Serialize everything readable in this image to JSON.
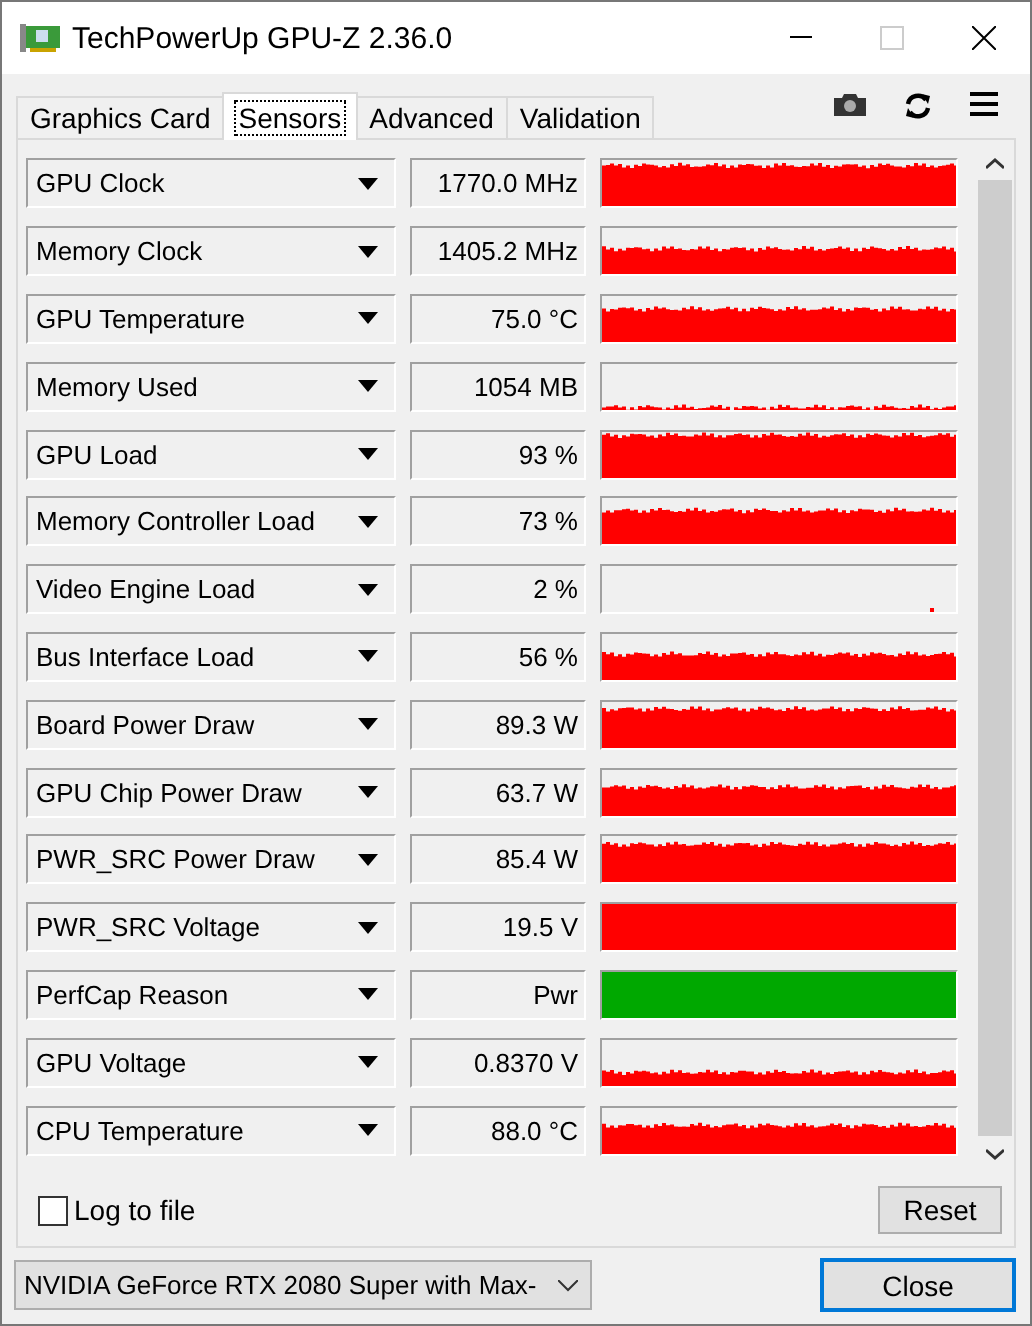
{
  "window": {
    "title": "TechPowerUp GPU-Z 2.36.0"
  },
  "tabs": [
    {
      "label": "Graphics Card",
      "selected": false
    },
    {
      "label": "Sensors",
      "selected": true
    },
    {
      "label": "Advanced",
      "selected": false
    },
    {
      "label": "Validation",
      "selected": false
    }
  ],
  "sensors": [
    {
      "name": "GPU Clock",
      "reading": "1770.0 MHz",
      "color": "#ff0000"
    },
    {
      "name": "Memory Clock",
      "reading": "1405.2 MHz",
      "color": "#ff0000"
    },
    {
      "name": "GPU Temperature",
      "reading": "75.0 °C",
      "color": "#ff0000"
    },
    {
      "name": "Memory Used",
      "reading": "1054 MB",
      "color": "#ff0000"
    },
    {
      "name": "GPU Load",
      "reading": "93 %",
      "color": "#ff0000"
    },
    {
      "name": "Memory Controller Load",
      "reading": "73 %",
      "color": "#ff0000"
    },
    {
      "name": "Video Engine Load",
      "reading": "2 %",
      "color": "#ff0000"
    },
    {
      "name": "Bus Interface Load",
      "reading": "56 %",
      "color": "#ff0000"
    },
    {
      "name": "Board Power Draw",
      "reading": "89.3 W",
      "color": "#ff0000"
    },
    {
      "name": "GPU Chip Power Draw",
      "reading": "63.7 W",
      "color": "#ff0000"
    },
    {
      "name": "PWR_SRC Power Draw",
      "reading": "85.4 W",
      "color": "#ff0000"
    },
    {
      "name": "PWR_SRC Voltage",
      "reading": "19.5 V",
      "color": "#ff0000"
    },
    {
      "name": "PerfCap Reason",
      "reading": "Pwr",
      "color": "#00a800"
    },
    {
      "name": "GPU Voltage",
      "reading": "0.8370 V",
      "color": "#ff0000"
    },
    {
      "name": "CPU Temperature",
      "reading": "88.0 °C",
      "color": "#ff0000"
    }
  ],
  "log_to_file": {
    "label": "Log to file",
    "checked": false
  },
  "reset_button": "Reset",
  "gpu_select": {
    "value": "NVIDIA GeForce RTX 2080 Super with Max-"
  },
  "close_button": "Close"
}
